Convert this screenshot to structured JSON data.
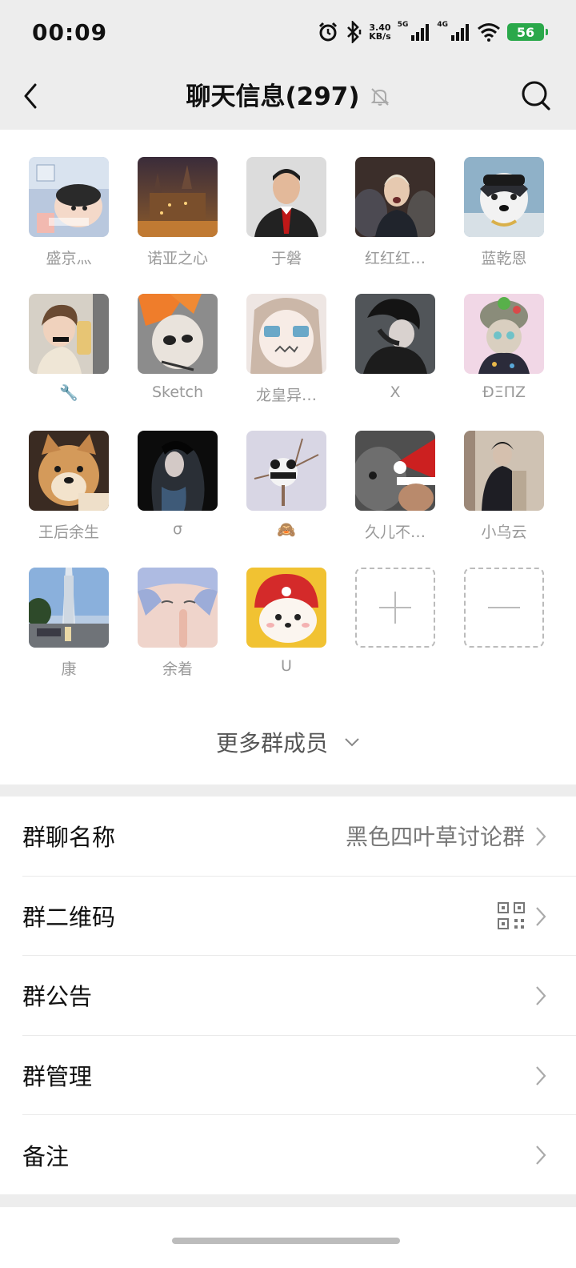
{
  "status": {
    "time": "00:09",
    "net_speed_value": "3.40",
    "net_speed_unit": "KB/s",
    "sig1": "5G",
    "sig2": "4G",
    "battery": "56"
  },
  "nav": {
    "title": "聊天信息(297)"
  },
  "members": [
    {
      "name": "盛京灬"
    },
    {
      "name": "诺亚之心"
    },
    {
      "name": "于磐"
    },
    {
      "name": "红红红…"
    },
    {
      "name": "蓝乾恩"
    },
    {
      "name": "🔧"
    },
    {
      "name": "Sketch"
    },
    {
      "name": "龙皇异…"
    },
    {
      "name": "X"
    },
    {
      "name": "ÐΞΠZ"
    },
    {
      "name": "王后余生"
    },
    {
      "name": "σ"
    },
    {
      "name": "🙈"
    },
    {
      "name": "久儿不…"
    },
    {
      "name": "小乌云"
    },
    {
      "name": "康"
    },
    {
      "name": "余着"
    },
    {
      "name": "U"
    }
  ],
  "more_members_label": "更多群成员",
  "settings": {
    "group_name_label": "群聊名称",
    "group_name_value": "黑色四叶草讨论群",
    "qr_label": "群二维码",
    "notice_label": "群公告",
    "manage_label": "群管理",
    "remark_label": "备注"
  },
  "colors": {
    "background": "#ededed",
    "battery": "#2aa84a"
  }
}
